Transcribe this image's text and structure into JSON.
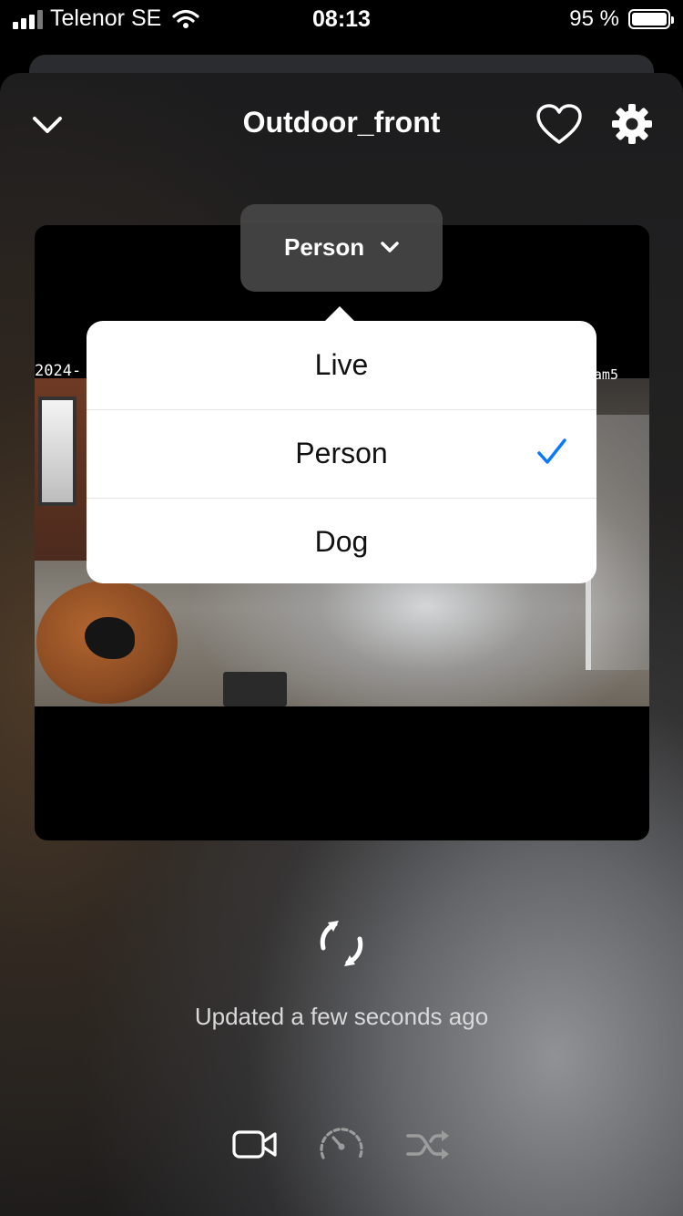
{
  "status_bar": {
    "carrier": "Telenor SE",
    "time": "08:13",
    "battery_percent": "95 %",
    "battery_level": 0.95
  },
  "header": {
    "title": "Outdoor_front",
    "back_icon": "chevron-down-icon",
    "favorite_icon": "heart-icon",
    "settings_icon": "gear-icon"
  },
  "camera_feed": {
    "date_overlay": "2024-",
    "camera_overlay": "am5"
  },
  "filter": {
    "selected_label": "Person",
    "options": [
      "Live",
      "Person",
      "Dog"
    ],
    "selected_index": 1,
    "check_color": "#0a7aff"
  },
  "status": {
    "updated_text": "Updated a few seconds ago",
    "refresh_icon": "refresh-icon"
  },
  "toolbar": {
    "video_icon": "video-camera-icon",
    "speed_icon": "speedometer-icon",
    "shuffle_icon": "shuffle-icon"
  }
}
